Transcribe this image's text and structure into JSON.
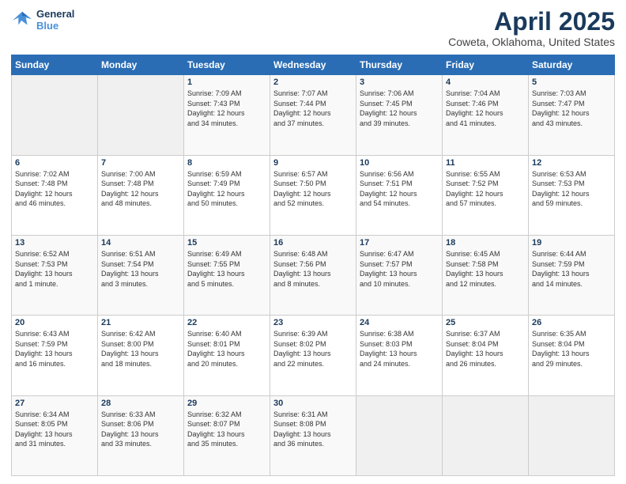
{
  "header": {
    "logo_line1": "General",
    "logo_line2": "Blue",
    "title": "April 2025",
    "subtitle": "Coweta, Oklahoma, United States"
  },
  "calendar": {
    "headers": [
      "Sunday",
      "Monday",
      "Tuesday",
      "Wednesday",
      "Thursday",
      "Friday",
      "Saturday"
    ],
    "rows": [
      [
        {
          "day": "",
          "info": ""
        },
        {
          "day": "",
          "info": ""
        },
        {
          "day": "1",
          "info": "Sunrise: 7:09 AM\nSunset: 7:43 PM\nDaylight: 12 hours\nand 34 minutes."
        },
        {
          "day": "2",
          "info": "Sunrise: 7:07 AM\nSunset: 7:44 PM\nDaylight: 12 hours\nand 37 minutes."
        },
        {
          "day": "3",
          "info": "Sunrise: 7:06 AM\nSunset: 7:45 PM\nDaylight: 12 hours\nand 39 minutes."
        },
        {
          "day": "4",
          "info": "Sunrise: 7:04 AM\nSunset: 7:46 PM\nDaylight: 12 hours\nand 41 minutes."
        },
        {
          "day": "5",
          "info": "Sunrise: 7:03 AM\nSunset: 7:47 PM\nDaylight: 12 hours\nand 43 minutes."
        }
      ],
      [
        {
          "day": "6",
          "info": "Sunrise: 7:02 AM\nSunset: 7:48 PM\nDaylight: 12 hours\nand 46 minutes."
        },
        {
          "day": "7",
          "info": "Sunrise: 7:00 AM\nSunset: 7:48 PM\nDaylight: 12 hours\nand 48 minutes."
        },
        {
          "day": "8",
          "info": "Sunrise: 6:59 AM\nSunset: 7:49 PM\nDaylight: 12 hours\nand 50 minutes."
        },
        {
          "day": "9",
          "info": "Sunrise: 6:57 AM\nSunset: 7:50 PM\nDaylight: 12 hours\nand 52 minutes."
        },
        {
          "day": "10",
          "info": "Sunrise: 6:56 AM\nSunset: 7:51 PM\nDaylight: 12 hours\nand 54 minutes."
        },
        {
          "day": "11",
          "info": "Sunrise: 6:55 AM\nSunset: 7:52 PM\nDaylight: 12 hours\nand 57 minutes."
        },
        {
          "day": "12",
          "info": "Sunrise: 6:53 AM\nSunset: 7:53 PM\nDaylight: 12 hours\nand 59 minutes."
        }
      ],
      [
        {
          "day": "13",
          "info": "Sunrise: 6:52 AM\nSunset: 7:53 PM\nDaylight: 13 hours\nand 1 minute."
        },
        {
          "day": "14",
          "info": "Sunrise: 6:51 AM\nSunset: 7:54 PM\nDaylight: 13 hours\nand 3 minutes."
        },
        {
          "day": "15",
          "info": "Sunrise: 6:49 AM\nSunset: 7:55 PM\nDaylight: 13 hours\nand 5 minutes."
        },
        {
          "day": "16",
          "info": "Sunrise: 6:48 AM\nSunset: 7:56 PM\nDaylight: 13 hours\nand 8 minutes."
        },
        {
          "day": "17",
          "info": "Sunrise: 6:47 AM\nSunset: 7:57 PM\nDaylight: 13 hours\nand 10 minutes."
        },
        {
          "day": "18",
          "info": "Sunrise: 6:45 AM\nSunset: 7:58 PM\nDaylight: 13 hours\nand 12 minutes."
        },
        {
          "day": "19",
          "info": "Sunrise: 6:44 AM\nSunset: 7:59 PM\nDaylight: 13 hours\nand 14 minutes."
        }
      ],
      [
        {
          "day": "20",
          "info": "Sunrise: 6:43 AM\nSunset: 7:59 PM\nDaylight: 13 hours\nand 16 minutes."
        },
        {
          "day": "21",
          "info": "Sunrise: 6:42 AM\nSunset: 8:00 PM\nDaylight: 13 hours\nand 18 minutes."
        },
        {
          "day": "22",
          "info": "Sunrise: 6:40 AM\nSunset: 8:01 PM\nDaylight: 13 hours\nand 20 minutes."
        },
        {
          "day": "23",
          "info": "Sunrise: 6:39 AM\nSunset: 8:02 PM\nDaylight: 13 hours\nand 22 minutes."
        },
        {
          "day": "24",
          "info": "Sunrise: 6:38 AM\nSunset: 8:03 PM\nDaylight: 13 hours\nand 24 minutes."
        },
        {
          "day": "25",
          "info": "Sunrise: 6:37 AM\nSunset: 8:04 PM\nDaylight: 13 hours\nand 26 minutes."
        },
        {
          "day": "26",
          "info": "Sunrise: 6:35 AM\nSunset: 8:04 PM\nDaylight: 13 hours\nand 29 minutes."
        }
      ],
      [
        {
          "day": "27",
          "info": "Sunrise: 6:34 AM\nSunset: 8:05 PM\nDaylight: 13 hours\nand 31 minutes."
        },
        {
          "day": "28",
          "info": "Sunrise: 6:33 AM\nSunset: 8:06 PM\nDaylight: 13 hours\nand 33 minutes."
        },
        {
          "day": "29",
          "info": "Sunrise: 6:32 AM\nSunset: 8:07 PM\nDaylight: 13 hours\nand 35 minutes."
        },
        {
          "day": "30",
          "info": "Sunrise: 6:31 AM\nSunset: 8:08 PM\nDaylight: 13 hours\nand 36 minutes."
        },
        {
          "day": "",
          "info": ""
        },
        {
          "day": "",
          "info": ""
        },
        {
          "day": "",
          "info": ""
        }
      ]
    ]
  }
}
